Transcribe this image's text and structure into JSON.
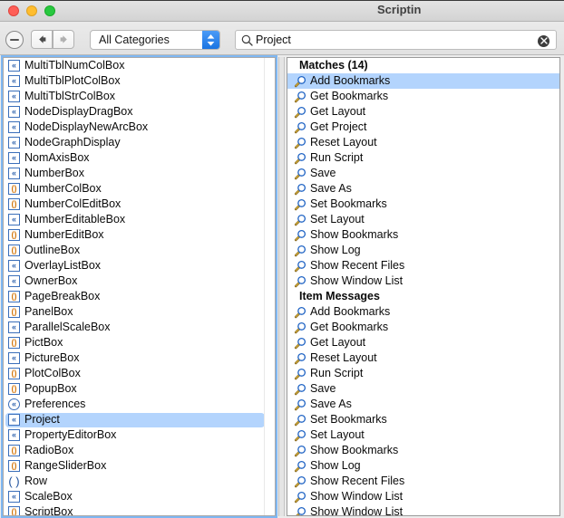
{
  "window": {
    "title": "Scriptin",
    "traffic_lights": [
      {
        "name": "close",
        "color": "#ff5f57"
      },
      {
        "name": "minimize",
        "color": "#ffbd2e"
      },
      {
        "name": "zoom",
        "color": "#28c840"
      }
    ]
  },
  "toolbar": {
    "stop_button_label": "",
    "back_label": "",
    "forward_label": "",
    "category": {
      "selected": "All Categories",
      "options": [
        "All Categories"
      ]
    },
    "search": {
      "value": "Project",
      "placeholder": "Search",
      "clear_label": ""
    }
  },
  "left_panel": {
    "items": [
      {
        "label": "MultiTblNumColBox",
        "icon": "class-icon",
        "icon_kind": "sq-blue",
        "glyph": "«",
        "selected": false
      },
      {
        "label": "MultiTblPlotColBox",
        "icon": "class-icon",
        "icon_kind": "sq-blue",
        "glyph": "«",
        "selected": false
      },
      {
        "label": "MultiTblStrColBox",
        "icon": "class-icon",
        "icon_kind": "sq-blue",
        "glyph": "«",
        "selected": false
      },
      {
        "label": "NodeDisplayDragBox",
        "icon": "class-icon",
        "icon_kind": "sq-blue",
        "glyph": "«",
        "selected": false
      },
      {
        "label": "NodeDisplayNewArcBox",
        "icon": "class-icon",
        "icon_kind": "sq-blue",
        "glyph": "«",
        "selected": false
      },
      {
        "label": "NodeGraphDisplay",
        "icon": "class-icon",
        "icon_kind": "sq-blue",
        "glyph": "«",
        "selected": false
      },
      {
        "label": "NomAxisBox",
        "icon": "class-icon",
        "icon_kind": "sq-blue",
        "glyph": "«",
        "selected": false
      },
      {
        "label": "NumberBox",
        "icon": "class-icon",
        "icon_kind": "sq-blue",
        "glyph": "«",
        "selected": false
      },
      {
        "label": "NumberColBox",
        "icon": "function-icon",
        "icon_kind": "sq-orange",
        "glyph": "()",
        "selected": false
      },
      {
        "label": "NumberColEditBox",
        "icon": "function-icon",
        "icon_kind": "sq-orange",
        "glyph": "()",
        "selected": false
      },
      {
        "label": "NumberEditableBox",
        "icon": "class-icon",
        "icon_kind": "sq-blue",
        "glyph": "«",
        "selected": false
      },
      {
        "label": "NumberEditBox",
        "icon": "function-icon",
        "icon_kind": "sq-orange",
        "glyph": "()",
        "selected": false
      },
      {
        "label": "OutlineBox",
        "icon": "function-icon",
        "icon_kind": "sq-orange",
        "glyph": "()",
        "selected": false
      },
      {
        "label": "OverlayListBox",
        "icon": "class-icon",
        "icon_kind": "sq-blue",
        "glyph": "«",
        "selected": false
      },
      {
        "label": "OwnerBox",
        "icon": "class-icon",
        "icon_kind": "sq-blue",
        "glyph": "«",
        "selected": false
      },
      {
        "label": "PageBreakBox",
        "icon": "function-icon",
        "icon_kind": "sq-orange",
        "glyph": "()",
        "selected": false
      },
      {
        "label": "PanelBox",
        "icon": "function-icon",
        "icon_kind": "sq-orange",
        "glyph": "()",
        "selected": false
      },
      {
        "label": "ParallelScaleBox",
        "icon": "class-icon",
        "icon_kind": "sq-blue",
        "glyph": "«",
        "selected": false
      },
      {
        "label": "PictBox",
        "icon": "function-icon",
        "icon_kind": "sq-orange",
        "glyph": "()",
        "selected": false
      },
      {
        "label": "PictureBox",
        "icon": "class-icon",
        "icon_kind": "sq-blue",
        "glyph": "«",
        "selected": false
      },
      {
        "label": "PlotColBox",
        "icon": "function-icon",
        "icon_kind": "sq-orange",
        "glyph": "()",
        "selected": false
      },
      {
        "label": "PopupBox",
        "icon": "function-icon",
        "icon_kind": "sq-orange",
        "glyph": "()",
        "selected": false
      },
      {
        "label": "Preferences",
        "icon": "object-icon",
        "icon_kind": "circ-blue",
        "glyph": "«",
        "selected": false
      },
      {
        "label": "Project",
        "icon": "class-icon",
        "icon_kind": "sq-blue",
        "glyph": "«",
        "selected": true
      },
      {
        "label": "PropertyEditorBox",
        "icon": "class-icon",
        "icon_kind": "sq-blue",
        "glyph": "«",
        "selected": false
      },
      {
        "label": "RadioBox",
        "icon": "function-icon",
        "icon_kind": "sq-orange",
        "glyph": "()",
        "selected": false
      },
      {
        "label": "RangeSliderBox",
        "icon": "function-icon",
        "icon_kind": "sq-orange",
        "glyph": "()",
        "selected": false
      },
      {
        "label": "Row",
        "icon": "plain-function-icon",
        "icon_kind": "plain",
        "glyph": "( )",
        "selected": false
      },
      {
        "label": "ScaleBox",
        "icon": "class-icon",
        "icon_kind": "sq-blue",
        "glyph": "«",
        "selected": false
      },
      {
        "label": "ScriptBox",
        "icon": "function-icon",
        "icon_kind": "sq-orange",
        "glyph": "()",
        "selected": false
      }
    ]
  },
  "right_panel": {
    "items": [
      {
        "label": "Matches (14)",
        "kind": "header",
        "selected": false
      },
      {
        "label": "Add Bookmarks",
        "kind": "item",
        "icon": "magnifier-icon",
        "selected": true
      },
      {
        "label": "Get Bookmarks",
        "kind": "item",
        "icon": "magnifier-icon",
        "selected": false
      },
      {
        "label": "Get Layout",
        "kind": "item",
        "icon": "magnifier-icon",
        "selected": false
      },
      {
        "label": "Get Project",
        "kind": "item",
        "icon": "magnifier-icon",
        "selected": false
      },
      {
        "label": "Reset Layout",
        "kind": "item",
        "icon": "magnifier-icon",
        "selected": false
      },
      {
        "label": "Run Script",
        "kind": "item",
        "icon": "magnifier-icon",
        "selected": false
      },
      {
        "label": "Save",
        "kind": "item",
        "icon": "magnifier-icon",
        "selected": false
      },
      {
        "label": "Save As",
        "kind": "item",
        "icon": "magnifier-icon",
        "selected": false
      },
      {
        "label": "Set Bookmarks",
        "kind": "item",
        "icon": "magnifier-icon",
        "selected": false
      },
      {
        "label": "Set Layout",
        "kind": "item",
        "icon": "magnifier-icon",
        "selected": false
      },
      {
        "label": "Show Bookmarks",
        "kind": "item",
        "icon": "magnifier-icon",
        "selected": false
      },
      {
        "label": "Show Log",
        "kind": "item",
        "icon": "magnifier-icon",
        "selected": false
      },
      {
        "label": "Show Recent Files",
        "kind": "item",
        "icon": "magnifier-icon",
        "selected": false
      },
      {
        "label": "Show Window List",
        "kind": "item",
        "icon": "magnifier-icon",
        "selected": false
      },
      {
        "label": "Item Messages",
        "kind": "header",
        "selected": false
      },
      {
        "label": "Add Bookmarks",
        "kind": "item",
        "icon": "magnifier-icon",
        "selected": false
      },
      {
        "label": "Get Bookmarks",
        "kind": "item",
        "icon": "magnifier-icon",
        "selected": false
      },
      {
        "label": "Get Layout",
        "kind": "item",
        "icon": "magnifier-icon",
        "selected": false
      },
      {
        "label": "Reset Layout",
        "kind": "item",
        "icon": "magnifier-icon",
        "selected": false
      },
      {
        "label": "Run Script",
        "kind": "item",
        "icon": "magnifier-icon",
        "selected": false
      },
      {
        "label": "Save",
        "kind": "item",
        "icon": "magnifier-icon",
        "selected": false
      },
      {
        "label": "Save As",
        "kind": "item",
        "icon": "magnifier-icon",
        "selected": false
      },
      {
        "label": "Set Bookmarks",
        "kind": "item",
        "icon": "magnifier-icon",
        "selected": false
      },
      {
        "label": "Set Layout",
        "kind": "item",
        "icon": "magnifier-icon",
        "selected": false
      },
      {
        "label": "Show Bookmarks",
        "kind": "item",
        "icon": "magnifier-icon",
        "selected": false
      },
      {
        "label": "Show Log",
        "kind": "item",
        "icon": "magnifier-icon",
        "selected": false
      },
      {
        "label": "Show Recent Files",
        "kind": "item",
        "icon": "magnifier-icon",
        "selected": false
      },
      {
        "label": "Show Window List",
        "kind": "item",
        "icon": "magnifier-icon",
        "selected": false
      },
      {
        "label": "Show Window List",
        "kind": "item",
        "icon": "magnifier-icon",
        "selected": false
      }
    ]
  },
  "colors": {
    "selection": "#b3d4fd",
    "focus_ring": "#7fb7f2",
    "accent_blue": "#1a74e2",
    "icon_blue": "#3b6fba",
    "icon_orange": "#d4780f"
  }
}
